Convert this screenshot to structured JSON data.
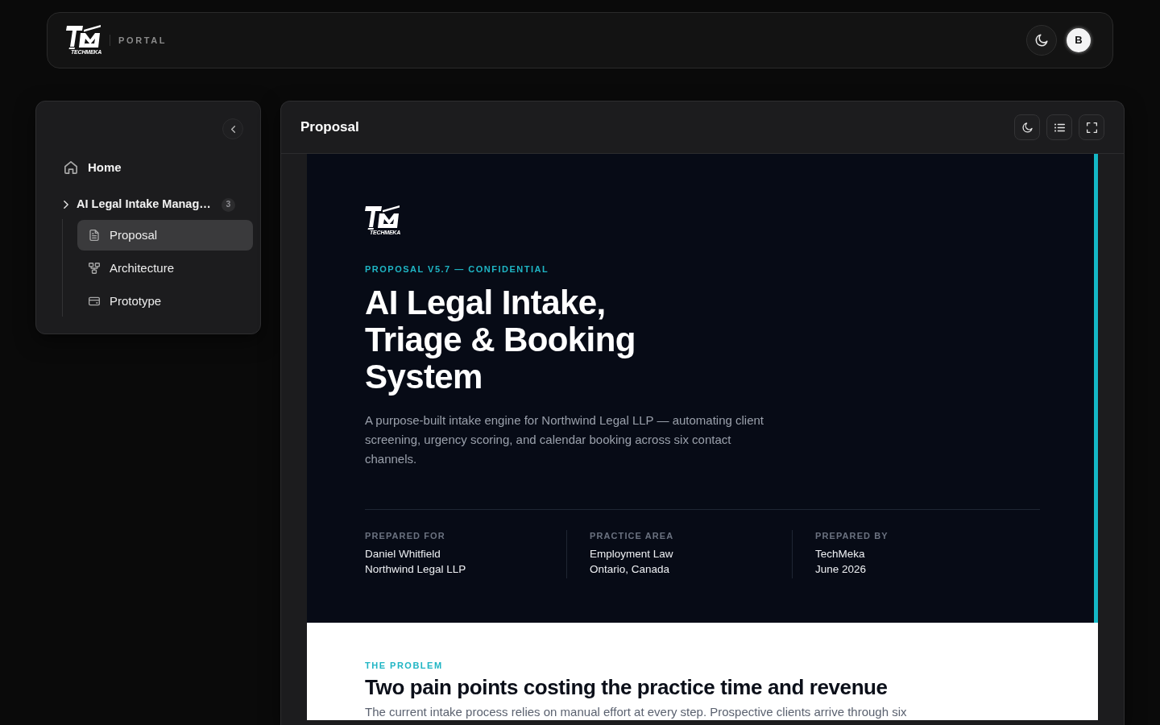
{
  "header": {
    "logo": {
      "wordmark": "TECHMEKA"
    },
    "section_label": "PORTAL",
    "avatar": {
      "initial": "B"
    }
  },
  "sidebar": {
    "home": {
      "label": "Home",
      "selected": false
    },
    "project": {
      "label": "AI Legal Intake Manag…",
      "count": "3",
      "children": [
        {
          "label": "Proposal",
          "selected": true
        },
        {
          "label": "Architecture",
          "selected": false
        },
        {
          "label": "Prototype",
          "selected": false
        }
      ]
    }
  },
  "panel": {
    "title": "Proposal"
  },
  "document": {
    "hero": {
      "logo": {
        "wordmark": "TECHMEKA"
      },
      "eyebrow": "PROPOSAL V5.7 — CONFIDENTIAL",
      "title": "AI Legal Intake, Triage & Booking System",
      "description": "A purpose-built intake engine for Northwind Legal LLP — automating client screening, urgency scoring, and calendar booking across six contact channels.",
      "meta": [
        {
          "label": "PREPARED FOR",
          "lines": [
            "Daniel Whitfield",
            "Northwind Legal LLP"
          ]
        },
        {
          "label": "PRACTICE AREA",
          "lines": [
            "Employment Law",
            "Ontario, Canada"
          ]
        },
        {
          "label": "PREPARED BY",
          "lines": [
            "TechMeka",
            "June 2026"
          ]
        }
      ]
    },
    "problem": {
      "eyebrow": "THE PROBLEM",
      "heading": "Two pain points costing the practice time and revenue",
      "text": "The current intake process relies on manual effort at every step. Prospective clients arrive through six"
    }
  }
}
